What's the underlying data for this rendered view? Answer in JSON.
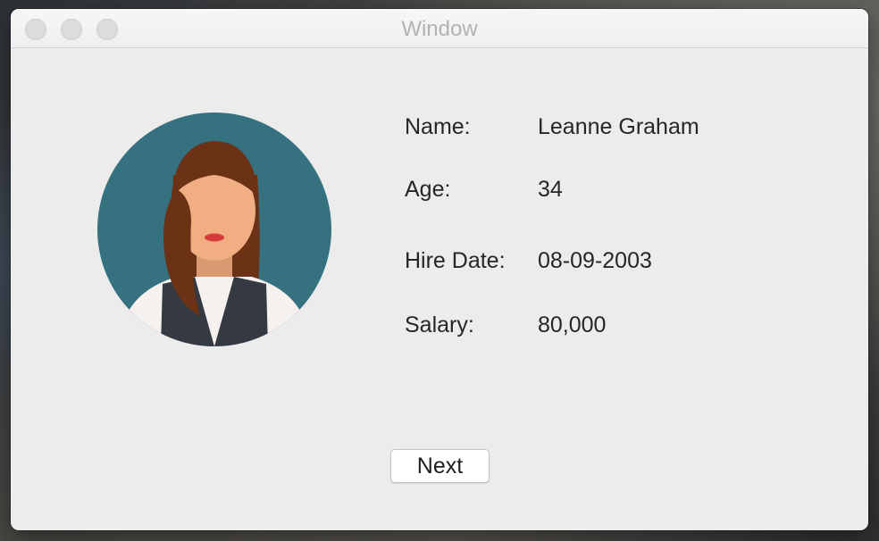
{
  "window": {
    "title": "Window"
  },
  "avatar": {
    "icon": "employee-avatar",
    "colors": {
      "background": "#36717f",
      "hair": "#6b3216",
      "skin": "#f0ae82",
      "vest": "#353941",
      "shirt": "#f5f1ee",
      "lips": "#d43c3c"
    }
  },
  "employee": {
    "name_label": "Name:",
    "name_value": "Leanne Graham",
    "age_label": "Age:",
    "age_value": "34",
    "hire_label": "Hire Date:",
    "hire_value": "08-09-2003",
    "salary_label": "Salary:",
    "salary_value": "80,000"
  },
  "actions": {
    "next_label": "Next"
  }
}
